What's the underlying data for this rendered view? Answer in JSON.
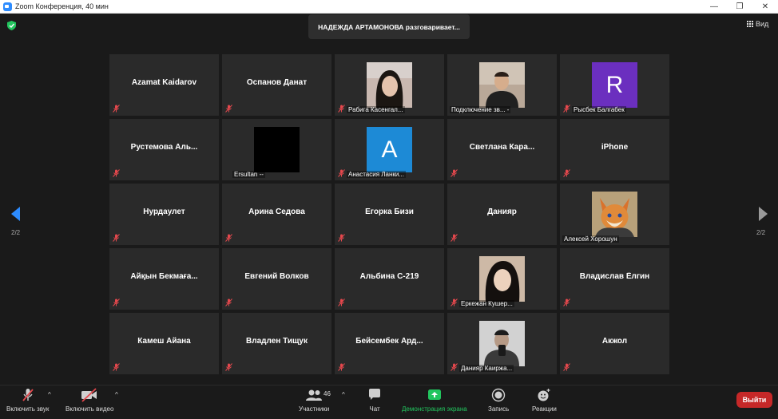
{
  "window": {
    "title": "Zoom Конференция, 40 мин",
    "controls": [
      "—",
      "❐",
      "✕"
    ]
  },
  "banner": {
    "text": "НАДЕЖДА АРТАМОНОВА разговаривает..."
  },
  "view_button": {
    "label": "Вид"
  },
  "pagination": {
    "left": "2/2",
    "right": "2/2"
  },
  "participants": [
    {
      "name": "Azamat Kaidarov",
      "video": "none"
    },
    {
      "name": "Оспанов Данат",
      "video": "none"
    },
    {
      "name": "Рабига Касенгал...",
      "video": "photo"
    },
    {
      "name": "Подключение зв... -",
      "video": "photo"
    },
    {
      "name": "Рысбек Балгабек",
      "video": "letter",
      "letter": "R",
      "color": "#6b2fbf"
    },
    {
      "name": "Рустемова Аль...",
      "video": "none"
    },
    {
      "name": "Ersultan --",
      "video": "black"
    },
    {
      "name": "Анастасия Ланки...",
      "video": "letter",
      "letter": "A",
      "color": "#1d8ad6"
    },
    {
      "name": "Светлана Кара...",
      "video": "none"
    },
    {
      "name": "iPhone",
      "video": "none"
    },
    {
      "name": "Нурдаулет",
      "video": "none"
    },
    {
      "name": "Арина Седова",
      "video": "none"
    },
    {
      "name": "Егорка Бизи",
      "video": "none"
    },
    {
      "name": "Данияр",
      "video": "none"
    },
    {
      "name": "Алексей Хорошун",
      "video": "photo"
    },
    {
      "name": "Айқын Бекмаға...",
      "video": "none"
    },
    {
      "name": "Евгений Волков",
      "video": "none"
    },
    {
      "name": "Альбина С-219",
      "video": "none"
    },
    {
      "name": "Еркежан Кушер...",
      "video": "photo"
    },
    {
      "name": "Владислав Ёлгин",
      "video": "none"
    },
    {
      "name": "Камеш Айана",
      "video": "none"
    },
    {
      "name": "Владлен Тищук",
      "video": "none"
    },
    {
      "name": "Бейсембек Ард...",
      "video": "none"
    },
    {
      "name": "Данияр Каиржа...",
      "video": "photo"
    },
    {
      "name": "Акжол",
      "video": "none"
    }
  ],
  "toolbar": {
    "mute": "Включить звук",
    "video": "Включить видео",
    "participants": "Участники",
    "participants_count": "46",
    "chat": "Чат",
    "share": "Демонстрация экрана",
    "record": "Запись",
    "reactions": "Реакции",
    "leave": "Выйти"
  },
  "colors": {
    "background": "#1a1a1a",
    "tile": "#2a2a2a",
    "accent_blue": "#2d8cff",
    "share_green": "#22c55e",
    "leave_red": "#c62828",
    "muted_red": "#e5484d"
  }
}
